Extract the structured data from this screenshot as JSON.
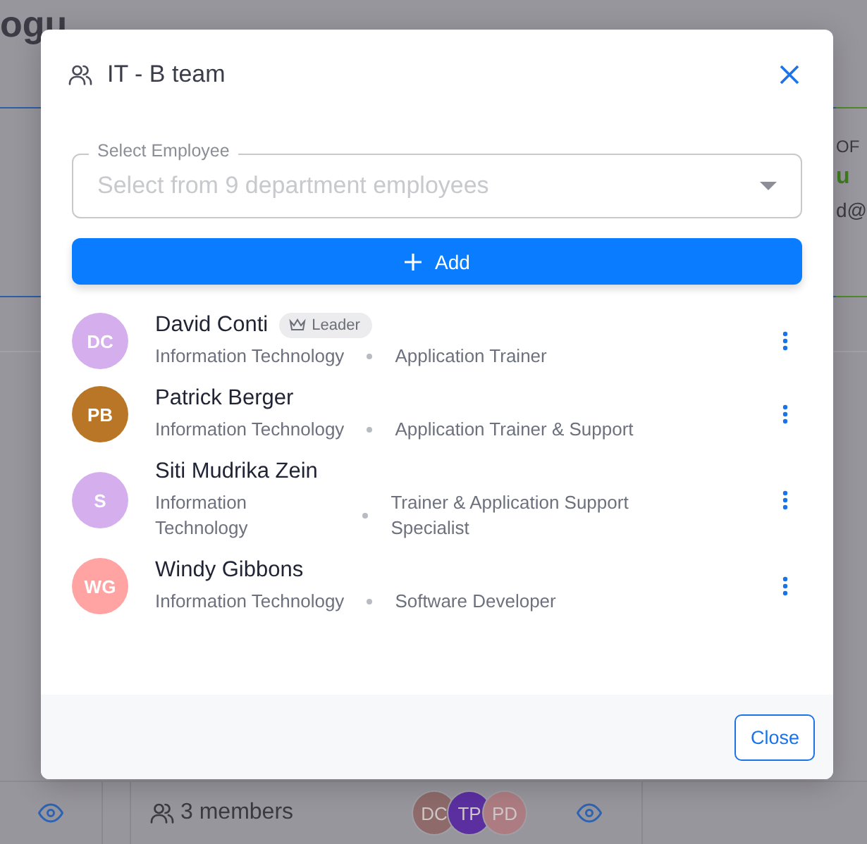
{
  "background": {
    "title": "ogu",
    "right_card": {
      "heading": "OF",
      "name": "u",
      "email": "d@"
    },
    "footer": {
      "members": "3 members",
      "avatars": [
        {
          "initials": "DC",
          "color": "#8e6a6a"
        },
        {
          "initials": "TP",
          "color": "#5b2fa0"
        },
        {
          "initials": "PD",
          "color": "#ad7c82"
        }
      ]
    }
  },
  "dialog": {
    "title": "IT - B team",
    "select": {
      "label": "Select Employee",
      "placeholder": "Select from 9 department employees"
    },
    "add_button": "Add",
    "members": [
      {
        "initials": "DC",
        "color": "#d5aeee",
        "name": "David Conti",
        "badge": "Leader",
        "department": "Information Technology",
        "position": "Application Trainer"
      },
      {
        "initials": "PB",
        "color": "#b87626",
        "name": "Patrick Berger",
        "department": "Information Technology",
        "position": "Application Trainer & Support"
      },
      {
        "initials": "S",
        "color": "#d5aeee",
        "name": "Siti Mudrika Zein",
        "department": "Information Technology",
        "position": "Trainer & Application Support Specialist"
      },
      {
        "initials": "WG",
        "color": "#ffa3a3",
        "name": "Windy Gibbons",
        "department": "Information Technology",
        "position": "Software Developer"
      }
    ],
    "close_button": "Close"
  }
}
